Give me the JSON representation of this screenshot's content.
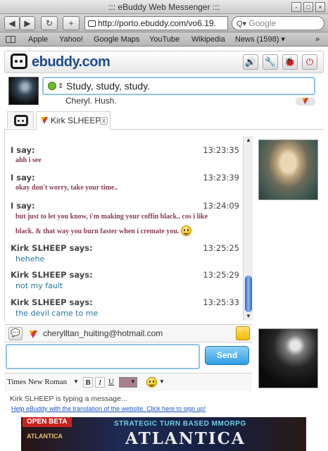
{
  "window": {
    "title": "::: eBuddy Web Messenger :::",
    "controls": [
      "-",
      "□",
      "×"
    ]
  },
  "toolbar": {
    "back": "◀",
    "forward": "▶",
    "reload": "↻",
    "add": "+",
    "url": "http://porto.ebuddy.com/vo6.19.",
    "search_placeholder": "Google",
    "search_icon": "Q▾"
  },
  "bookmarks": {
    "items": [
      "Apple",
      "Yahoo!",
      "Google Maps",
      "YouTube",
      "Wikipedia",
      "News (1598) ▾"
    ],
    "overflow": "»"
  },
  "ebuddy": {
    "logo_text": "ebuddy.com",
    "header_buttons": [
      {
        "icon": "speaker-icon",
        "glyph": "🔊"
      },
      {
        "icon": "wrench-icon",
        "glyph": "🔧"
      },
      {
        "icon": "bug-icon",
        "glyph": "🐞"
      },
      {
        "icon": "power-icon",
        "glyph": "⏻"
      }
    ]
  },
  "status": {
    "message": "Study, study, study.",
    "nickname": "Cheryl. Hush.",
    "arrow": "⇕",
    "color": "#6dbb2e"
  },
  "tabs": {
    "contact_tab": "Kirk SLHEEP",
    "close": "x"
  },
  "chat": {
    "messages": [
      {
        "sender": "I say:",
        "time": "13:23:35",
        "lines": [
          "ahh i see"
        ],
        "self": true
      },
      {
        "sender": "I say:",
        "time": "13:23:39",
        "lines": [
          "okay don't worry, take your time.."
        ],
        "self": true
      },
      {
        "sender": "I say:",
        "time": "13:24:09",
        "lines": [
          "but just to let you know, i'm making your coffin black.. cos i like",
          "black. & that way you burn faster when i cremate you."
        ],
        "self": true,
        "smiley": true
      },
      {
        "sender": "Kirk SLHEEP says:",
        "time": "13:25:25",
        "lines": [
          "hehehe"
        ],
        "self": false
      },
      {
        "sender": "Kirk SLHEEP says:",
        "time": "13:25:29",
        "lines": [
          "not my fault"
        ],
        "self": false
      },
      {
        "sender": "Kirk SLHEEP says:",
        "time": "13:25:33",
        "lines": [
          "the devil came to me"
        ],
        "self": false
      }
    ],
    "self_color": "#8a3a4e",
    "peer_color": "#23759b"
  },
  "compose": {
    "to": "cherylltan_huiting@hotmail.com",
    "send_label": "Send",
    "font_name": "Times New Roman",
    "bold": "B",
    "italic": "I",
    "underline": "U",
    "text_color": "#a7818c",
    "nudge_glyph": "⚡",
    "add_glyph": "💬"
  },
  "footer": {
    "typing": "Kirk SLHEEP is typing a message...",
    "help_link": "Help eBuddy with the translation of the website. Click here to sign up!"
  },
  "banner": {
    "badge": "OPEN BETA",
    "tagline": "STRATEGIC TURN BASED MMORPG",
    "game": "ATLANTICA",
    "logo": "ATLANTICA"
  }
}
